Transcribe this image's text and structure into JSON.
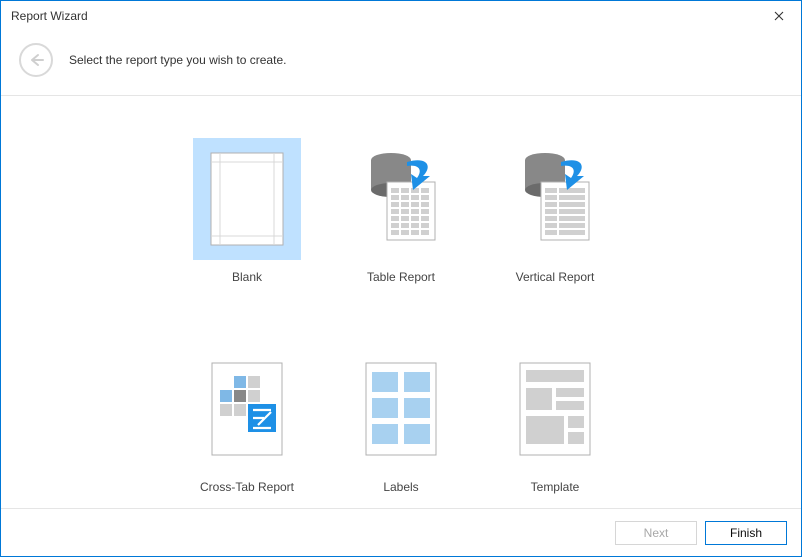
{
  "window": {
    "title": "Report Wizard"
  },
  "header": {
    "instruction": "Select the report type you wish to create."
  },
  "tiles": {
    "blank": {
      "label": "Blank",
      "selected": true
    },
    "table": {
      "label": "Table Report",
      "selected": false
    },
    "vertical": {
      "label": "Vertical Report",
      "selected": false
    },
    "crosstab": {
      "label": "Cross-Tab Report",
      "selected": false
    },
    "labels": {
      "label": "Labels",
      "selected": false
    },
    "template": {
      "label": "Template",
      "selected": false
    }
  },
  "footer": {
    "next": {
      "label": "Next",
      "enabled": false
    },
    "finish": {
      "label": "Finish",
      "enabled": true
    }
  },
  "colors": {
    "accent": "#0078d7",
    "selection": "#bfe1ff"
  }
}
